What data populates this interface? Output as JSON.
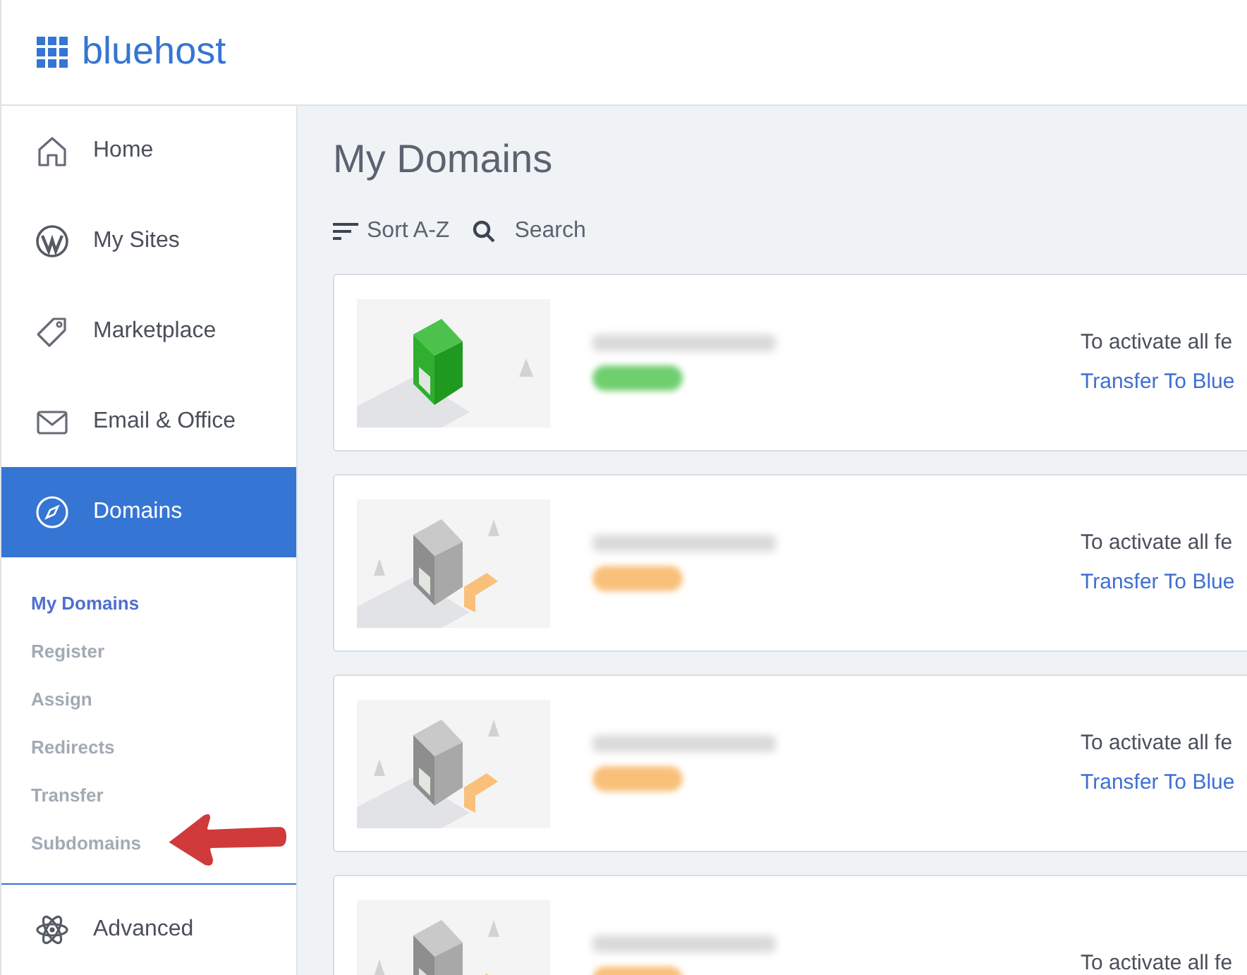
{
  "logo": {
    "text": "bluehost"
  },
  "sidebar": {
    "items": [
      {
        "label": "Home",
        "selected": false
      },
      {
        "label": "My Sites",
        "selected": false
      },
      {
        "label": "Marketplace",
        "selected": false
      },
      {
        "label": "Email & Office",
        "selected": false
      },
      {
        "label": "Domains",
        "selected": true,
        "children": [
          {
            "label": "My Domains",
            "selected": true
          },
          {
            "label": "Register",
            "selected": false
          },
          {
            "label": "Assign",
            "selected": false
          },
          {
            "label": "Redirects",
            "selected": false
          },
          {
            "label": "Transfer",
            "selected": false
          },
          {
            "label": "Subdomains",
            "selected": false
          }
        ]
      },
      {
        "label": "Advanced",
        "selected": false
      }
    ]
  },
  "page_title": "My Domains",
  "toolbar": {
    "sort": "Sort A-Z",
    "search": "Search"
  },
  "domains": [
    {
      "color": "#6fcf6f",
      "notice": "To activate all fe",
      "link": "Transfer To Blue"
    },
    {
      "color": "#f9c07a",
      "notice": "To activate all fe",
      "link": "Transfer To Blue"
    },
    {
      "color": "#f9c07a",
      "notice": "To activate all fe",
      "link": "Transfer To Blue"
    },
    {
      "color": "#f9c07a",
      "notice": "To activate all fe"
    }
  ]
}
